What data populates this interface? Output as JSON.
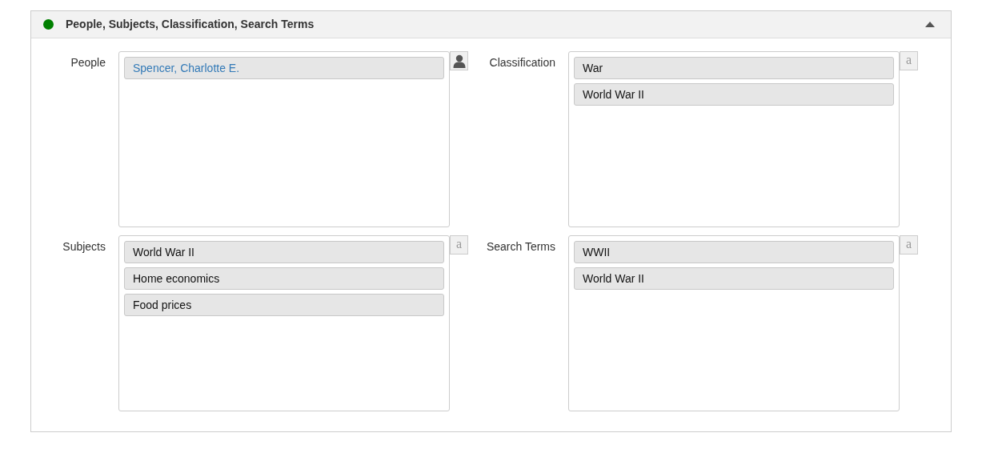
{
  "section": {
    "title": "People, Subjects, Classification, Search Terms",
    "status": {
      "color": "#008000"
    },
    "expanded": true
  },
  "fields": [
    {
      "label": "People",
      "button": {
        "kind": "person"
      },
      "items": [
        {
          "text": "Spencer, Charlotte E.",
          "kind": "link"
        }
      ]
    },
    {
      "label": "Classification",
      "button": {
        "kind": "text",
        "text": "a"
      },
      "items": [
        {
          "text": "War",
          "kind": "plain"
        },
        {
          "text": "World War II",
          "kind": "plain"
        }
      ]
    },
    {
      "label": "Subjects",
      "button": {
        "kind": "text",
        "text": "a"
      },
      "items": [
        {
          "text": "World War II",
          "kind": "plain"
        },
        {
          "text": "Home economics",
          "kind": "plain"
        },
        {
          "text": "Food prices",
          "kind": "plain"
        }
      ]
    },
    {
      "label": "Search Terms",
      "button": {
        "kind": "text",
        "text": "a"
      },
      "items": [
        {
          "text": "WWII",
          "kind": "plain"
        },
        {
          "text": "World War II",
          "kind": "plain"
        }
      ]
    }
  ]
}
